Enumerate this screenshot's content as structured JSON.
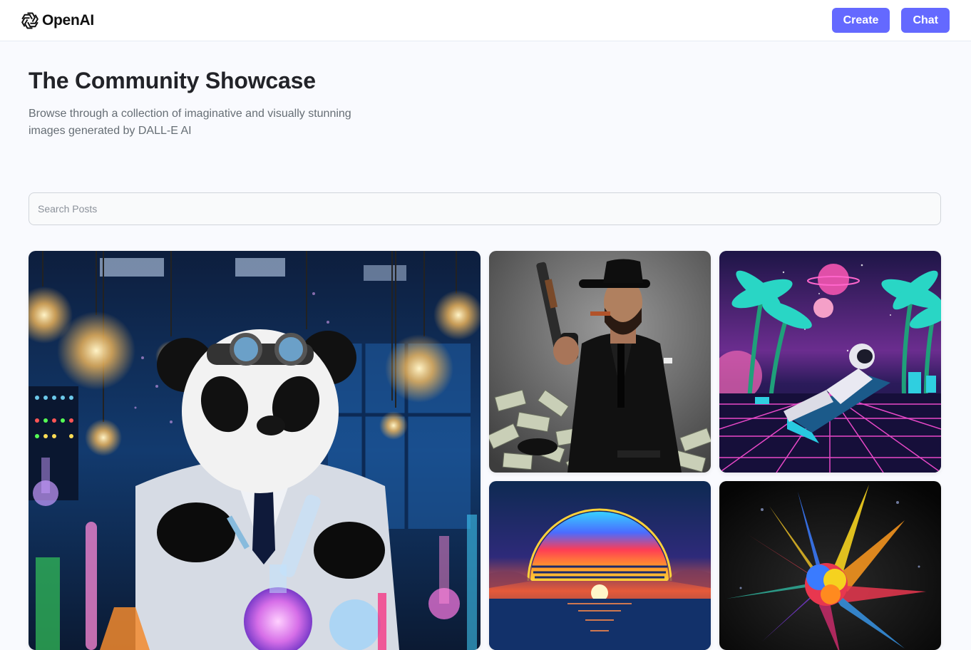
{
  "header": {
    "logo_text": "OpenAI",
    "create_label": "Create",
    "chat_label": "Chat"
  },
  "main": {
    "title": "The Community Showcase",
    "subtitle": "Browse through a collection of imaginative and visually stunning images generated by DALL-E AI",
    "search": {
      "placeholder": "Search Posts",
      "value": ""
    }
  },
  "posts": [
    {
      "subject": "panda scientist in laboratory"
    },
    {
      "subject": "man in black suit with cigar and revolver"
    },
    {
      "subject": "astronaut lounging in neon retrowave landscape"
    },
    {
      "subject": "sunset over ocean"
    },
    {
      "subject": "colorful powder explosion"
    }
  ],
  "colors": {
    "accent": "#6469ff",
    "background": "#f9fafe",
    "title": "#222328",
    "subtitle": "#666e75"
  }
}
